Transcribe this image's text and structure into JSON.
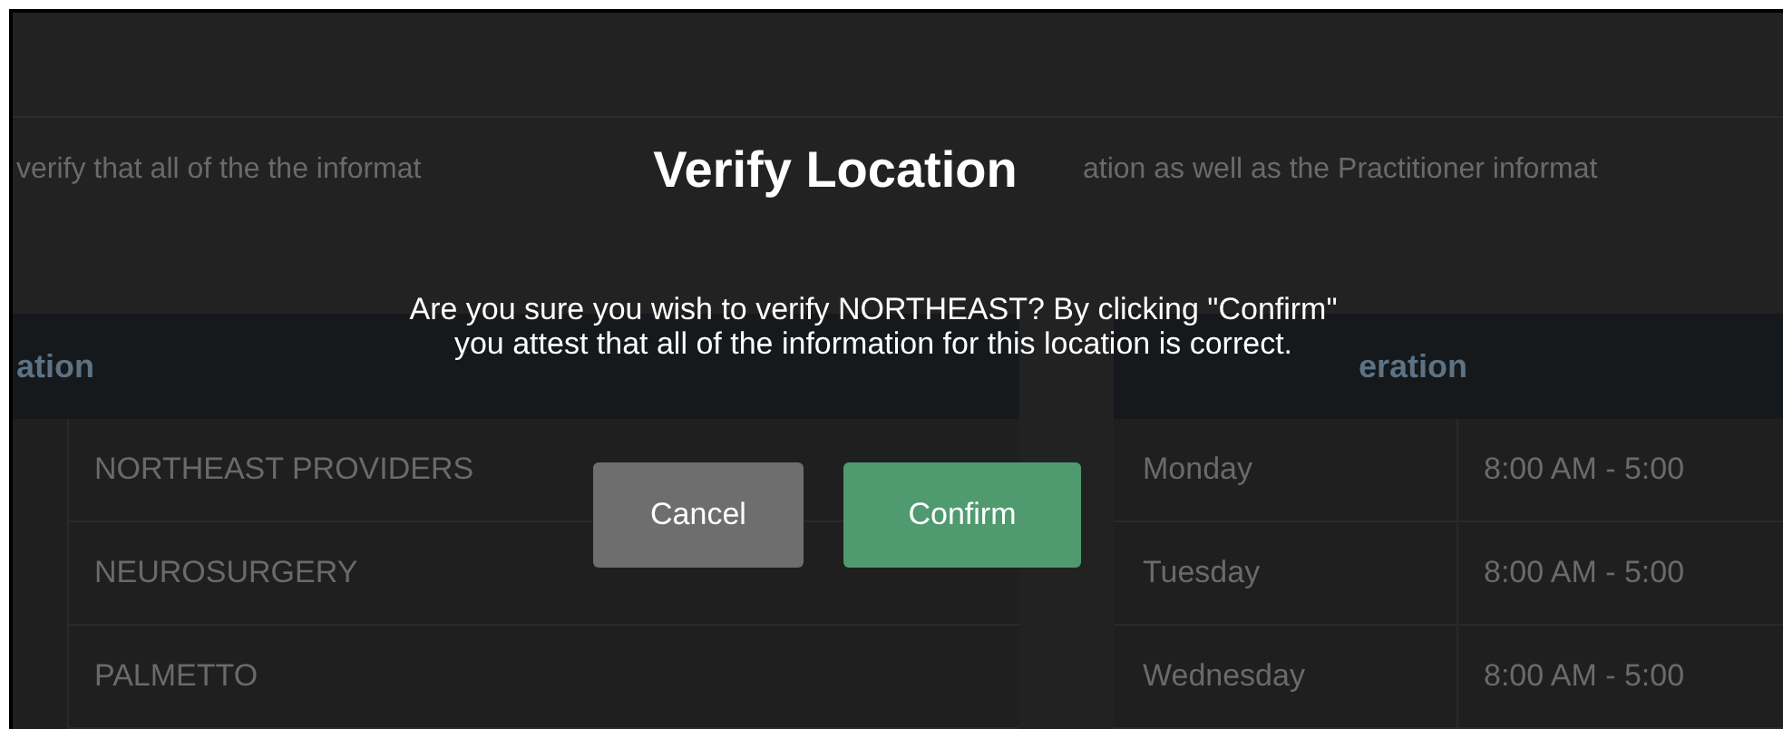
{
  "background_page": {
    "intro_text_fragments": [
      "verify that all of the the informat",
      "ation as well as the Practitioner informat"
    ],
    "locations_table": {
      "column_1": "ation",
      "rows": [
        "NORTHEAST PROVIDERS",
        "NEUROSURGERY",
        "PALMETTO"
      ]
    },
    "hours_table": {
      "column_1": "eration",
      "rows": [
        {
          "day": "Monday",
          "hours": "8:00 AM - 5:00"
        },
        {
          "day": "Tuesday",
          "hours": "8:00 AM - 5:00"
        },
        {
          "day": "Wednesday",
          "hours": "8:00 AM - 5:00"
        }
      ]
    }
  },
  "dialog": {
    "title": "Verify Location",
    "message": "Are you sure you wish to verify NORTHEAST? By clicking \"Confirm\"\nyou attest that all of the information for this location is correct.",
    "buttons": [
      {
        "label": "Cancel",
        "kind": "secondary"
      },
      {
        "label": "Confirm",
        "kind": "primary"
      }
    ]
  }
}
